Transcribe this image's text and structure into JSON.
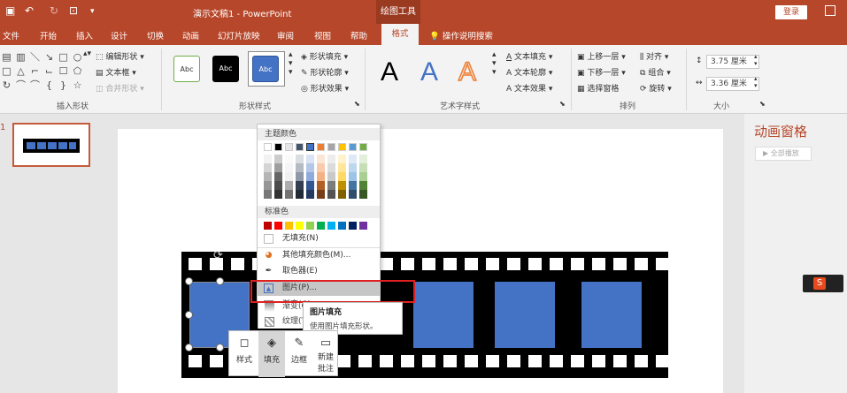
{
  "titlebar": {
    "doc_title": "演示文稿1  -  PowerPoint",
    "context_tool": "绘图工具",
    "login": "登录"
  },
  "tabs": [
    "文件",
    "开始",
    "插入",
    "设计",
    "切换",
    "动画",
    "幻灯片放映",
    "审阅",
    "视图",
    "帮助"
  ],
  "active_tab": "格式",
  "tell_me": "操作说明搜索",
  "ribbon": {
    "insert_shapes": {
      "label": "插入形状",
      "edit_shape": "编辑形状",
      "text_box": "文本框",
      "merge_shapes": "合并形状"
    },
    "shape_styles": {
      "label": "形状样式",
      "style_text": "Abc",
      "fill": "形状填充",
      "outline": "形状轮廓",
      "effects": "形状效果"
    },
    "wordart": {
      "label": "艺术字样式",
      "letter": "A",
      "text_fill": "文本填充",
      "text_outline": "文本轮廓",
      "text_effects": "文本效果"
    },
    "arrange": {
      "label": "排列",
      "bring_forward": "上移一层",
      "send_backward": "下移一层",
      "selection_pane": "选择窗格",
      "align": "对齐",
      "group": "组合",
      "rotate": "旋转"
    },
    "size": {
      "label": "大小",
      "height": "3.75 厘米",
      "width": "3.36 厘米"
    }
  },
  "slide_number": "1",
  "anim_pane": {
    "title": "动画窗格",
    "play_all": "全部播放"
  },
  "dropdown": {
    "theme_colors_label": "主题颜色",
    "standard_colors_label": "标准色",
    "theme_top": [
      "#ffffff",
      "#000000",
      "#e7e6e6",
      "#44546a",
      "#4472c4",
      "#ed7d31",
      "#a5a5a5",
      "#ffc000",
      "#5b9bd5",
      "#70ad47"
    ],
    "standard": [
      "#c00000",
      "#ff0000",
      "#ffc000",
      "#ffff00",
      "#92d050",
      "#00b050",
      "#00b0f0",
      "#0070c0",
      "#002060",
      "#7030a0"
    ],
    "no_fill": "无填充(N)",
    "more_colors": "其他填充颜色(M)...",
    "eyedropper": "取色器(E)",
    "picture": "图片(P)...",
    "gradient": "渐变(G)",
    "texture": "纹理(T)"
  },
  "tooltip": {
    "title": "图片填充",
    "desc": "使用图片填充形状。"
  },
  "minibar": {
    "style": "样式",
    "fill": "填充",
    "outline": "边框",
    "new_comment_1": "新建",
    "new_comment_2": "批注"
  }
}
